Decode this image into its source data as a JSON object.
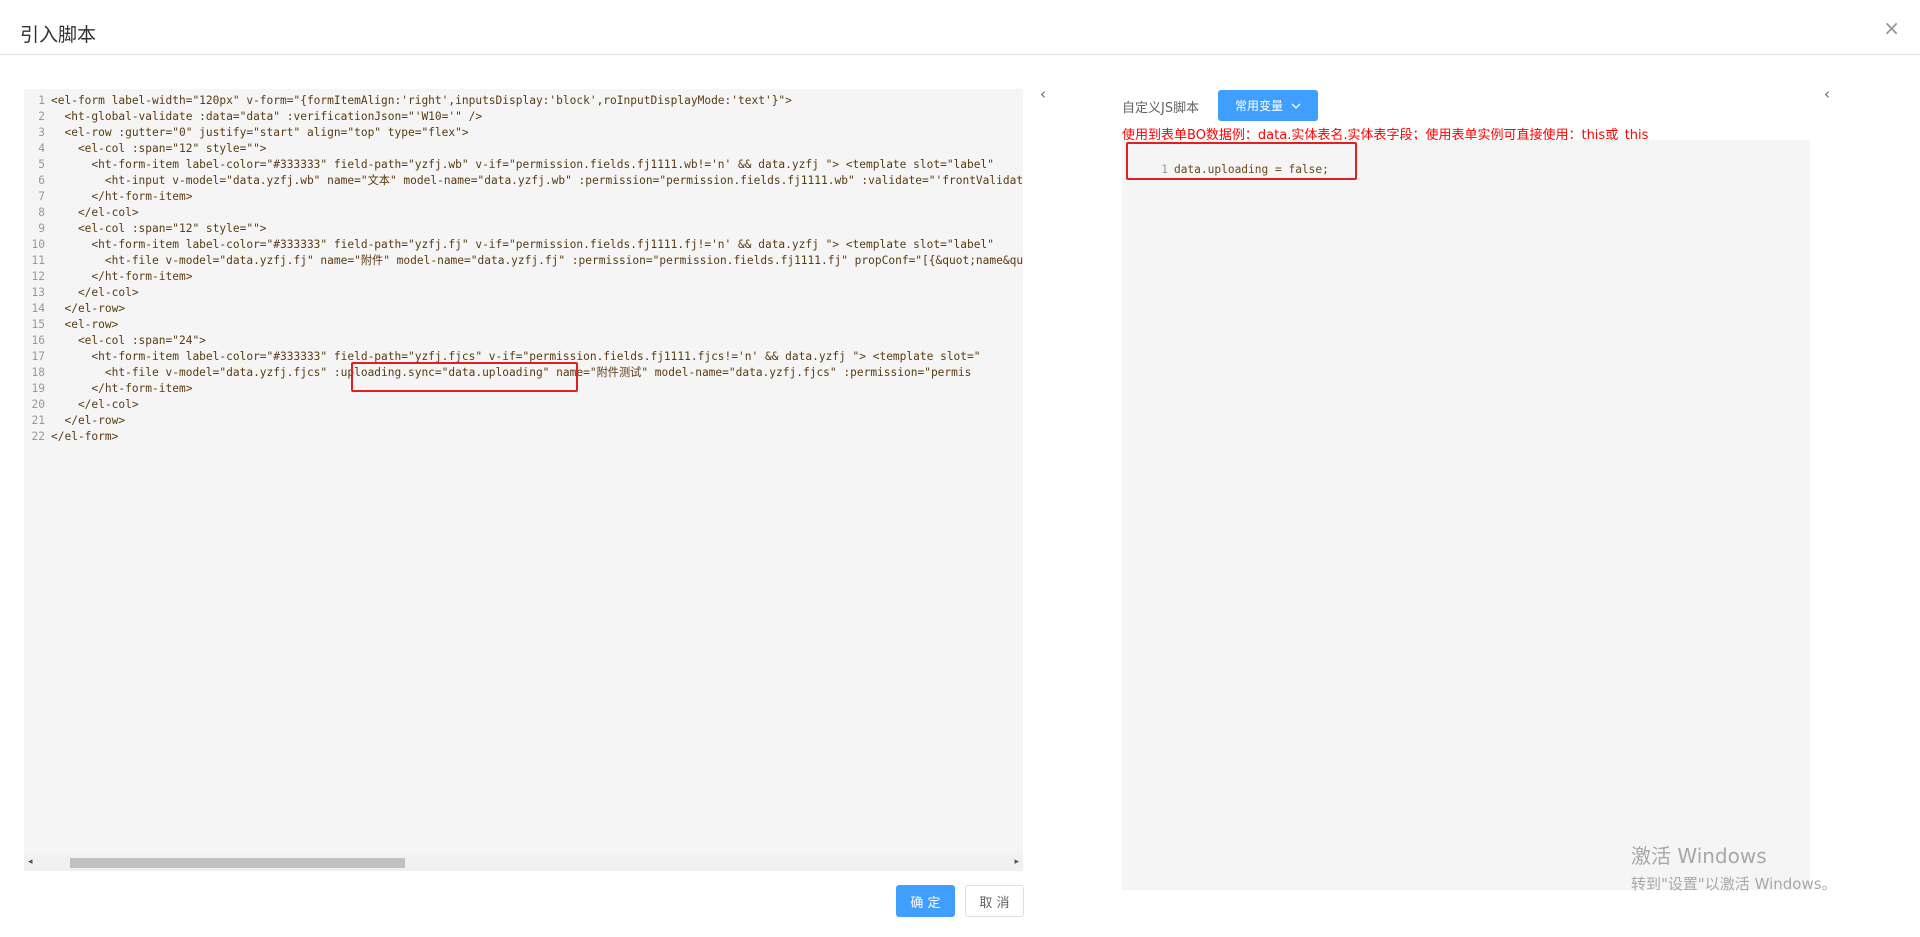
{
  "dialog": {
    "title": "引入脚本",
    "close_icon": "×"
  },
  "code_editor": {
    "lines": [
      {
        "n": "1",
        "text": "<el-form label-width=\"120px\" v-form=\"{formItemAlign:'right',inputsDisplay:'block',roInputDisplayMode:'text'}\">"
      },
      {
        "n": "2",
        "text": "  <ht-global-validate :data=\"data\" :verificationJson=\"'W10='\" />"
      },
      {
        "n": "3",
        "text": "  <el-row :gutter=\"0\" justify=\"start\" align=\"top\" type=\"flex\">"
      },
      {
        "n": "4",
        "text": "    <el-col :span=\"12\" style=\"\">"
      },
      {
        "n": "5",
        "text": "      <ht-form-item label-color=\"#333333\" field-path=\"yzfj.wb\" v-if=\"permission.fields.fj1111.wb!='n' && data.yzfj \"> <template slot=\"label\""
      },
      {
        "n": "6",
        "text": "        <ht-input v-model=\"data.yzfj.wb\" name=\"文本\" model-name=\"data.yzfj.wb\" :permission=\"permission.fields.fj1111.wb\" :validate=\"'frontValidate'"
      },
      {
        "n": "7",
        "text": "      </ht-form-item>"
      },
      {
        "n": "8",
        "text": "    </el-col>"
      },
      {
        "n": "9",
        "text": "    <el-col :span=\"12\" style=\"\">"
      },
      {
        "n": "10",
        "text": "      <ht-form-item label-color=\"#333333\" field-path=\"yzfj.fj\" v-if=\"permission.fields.fj1111.fj!='n' && data.yzfj \"> <template slot=\"label\""
      },
      {
        "n": "11",
        "text": "        <ht-file v-model=\"data.yzfj.fj\" name=\"附件\" model-name=\"data.yzfj.fj\" :permission=\"permission.fields.fj1111.fj\" propConf=\"[{&quot;name&quot;"
      },
      {
        "n": "12",
        "text": "      </ht-form-item>"
      },
      {
        "n": "13",
        "text": "    </el-col>"
      },
      {
        "n": "14",
        "text": "  </el-row>"
      },
      {
        "n": "15",
        "text": "  <el-row>"
      },
      {
        "n": "16",
        "text": "    <el-col :span=\"24\">"
      },
      {
        "n": "17",
        "text": "      <ht-form-item label-color=\"#333333\" field-path=\"yzfj.fjcs\" v-if=\"permission.fields.fj1111.fjcs!='n' && data.yzfj \"> <template slot=\""
      },
      {
        "n": "18",
        "text": "        <ht-file v-model=\"data.yzfj.fjcs\" :uploading.sync=\"data.uploading\" name=\"附件测试\" model-name=\"data.yzfj.fjcs\" :permission=\"permis"
      },
      {
        "n": "19",
        "text": "      </ht-form-item>"
      },
      {
        "n": "20",
        "text": "    </el-col>"
      },
      {
        "n": "21",
        "text": "  </el-row>"
      },
      {
        "n": "22",
        "text": "</el-form>"
      }
    ]
  },
  "collapse_left_icon": "‹",
  "collapse_right_icon": "‹",
  "buttons": {
    "ok": "确 定",
    "cancel": "取 消"
  },
  "js_script": {
    "label": "自定义JS脚本",
    "variables_button": "常用变量",
    "hint": "使用到表单BO数据例：data.实体表名.实体表字段；使用表单实例可直接使用：this或_this",
    "line_number": "1",
    "code": "data.uploading = false;"
  },
  "watermark": {
    "line1": "激活 Windows",
    "line2": "转到\"设置\"以激活 Windows。"
  },
  "colors": {
    "primary": "#409eff",
    "highlight": "#e02020",
    "hint": "#ff0000"
  }
}
